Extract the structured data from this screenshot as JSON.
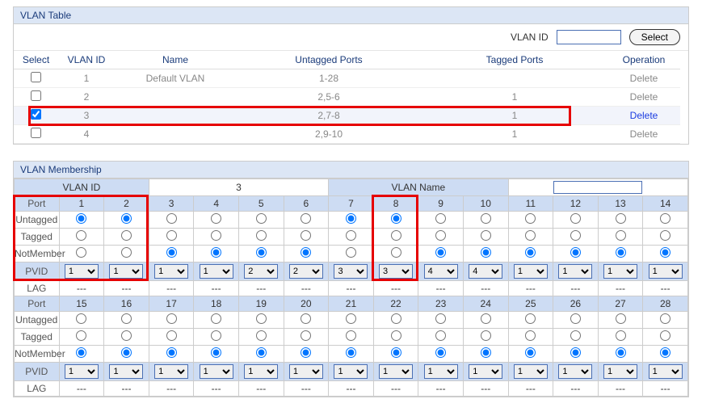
{
  "vlanTable": {
    "title": "VLAN Table",
    "filterLabel": "VLAN ID",
    "selectBtn": "Select",
    "headers": [
      "Select",
      "VLAN ID",
      "Name",
      "Untagged Ports",
      "Tagged Ports",
      "Operation"
    ],
    "rows": [
      {
        "checked": false,
        "vid": "1",
        "name": "Default VLAN",
        "untagged": "1-28",
        "tagged": "",
        "deleteActive": false,
        "highlight": false
      },
      {
        "checked": false,
        "vid": "2",
        "name": "",
        "untagged": "2,5-6",
        "tagged": "1",
        "deleteActive": false,
        "highlight": false
      },
      {
        "checked": true,
        "vid": "3",
        "name": "",
        "untagged": "2,7-8",
        "tagged": "1",
        "deleteActive": true,
        "highlight": true
      },
      {
        "checked": false,
        "vid": "4",
        "name": "",
        "untagged": "2,9-10",
        "tagged": "1",
        "deleteActive": false,
        "highlight": false
      }
    ],
    "deleteLabel": "Delete"
  },
  "membership": {
    "title": "VLAN Membership",
    "vlanIdLabel": "VLAN ID",
    "vlanIdValue": "3",
    "vlanNameLabel": "VLAN Name",
    "vlanNameValue": "",
    "rowLabels": {
      "port": "Port",
      "untagged": "Untagged",
      "tagged": "Tagged",
      "notMember": "NotMember",
      "pvid": "PVID",
      "lag": "LAG"
    },
    "lagValue": "---",
    "groups": [
      {
        "ports": [
          "1",
          "2",
          "3",
          "4",
          "5",
          "6",
          "7",
          "8",
          "9",
          "10",
          "11",
          "12",
          "13",
          "14"
        ],
        "state": [
          {
            "sel": "untagged",
            "pvid": "1"
          },
          {
            "sel": "untagged",
            "pvid": "1"
          },
          {
            "sel": "notmember",
            "pvid": "1"
          },
          {
            "sel": "notmember",
            "pvid": "1"
          },
          {
            "sel": "notmember",
            "pvid": "2"
          },
          {
            "sel": "notmember",
            "pvid": "2"
          },
          {
            "sel": "untagged",
            "pvid": "3"
          },
          {
            "sel": "untagged",
            "pvid": "3"
          },
          {
            "sel": "notmember",
            "pvid": "4"
          },
          {
            "sel": "notmember",
            "pvid": "4"
          },
          {
            "sel": "notmember",
            "pvid": "1"
          },
          {
            "sel": "notmember",
            "pvid": "1"
          },
          {
            "sel": "notmember",
            "pvid": "1"
          },
          {
            "sel": "notmember",
            "pvid": "1"
          }
        ]
      },
      {
        "ports": [
          "15",
          "16",
          "17",
          "18",
          "19",
          "20",
          "21",
          "22",
          "23",
          "24",
          "25",
          "26",
          "27",
          "28"
        ],
        "state": [
          {
            "sel": "notmember",
            "pvid": "1"
          },
          {
            "sel": "notmember",
            "pvid": "1"
          },
          {
            "sel": "notmember",
            "pvid": "1"
          },
          {
            "sel": "notmember",
            "pvid": "1"
          },
          {
            "sel": "notmember",
            "pvid": "1"
          },
          {
            "sel": "notmember",
            "pvid": "1"
          },
          {
            "sel": "notmember",
            "pvid": "1"
          },
          {
            "sel": "notmember",
            "pvid": "1"
          },
          {
            "sel": "notmember",
            "pvid": "1"
          },
          {
            "sel": "notmember",
            "pvid": "1"
          },
          {
            "sel": "notmember",
            "pvid": "1"
          },
          {
            "sel": "notmember",
            "pvid": "1"
          },
          {
            "sel": "notmember",
            "pvid": "1"
          },
          {
            "sel": "notmember",
            "pvid": "1"
          }
        ]
      }
    ],
    "pvidOptions": [
      "1",
      "2",
      "3",
      "4"
    ],
    "redBox1": {
      "cols": [
        0,
        2
      ]
    },
    "redBox2": {
      "cols": [
        6,
        8
      ]
    }
  }
}
